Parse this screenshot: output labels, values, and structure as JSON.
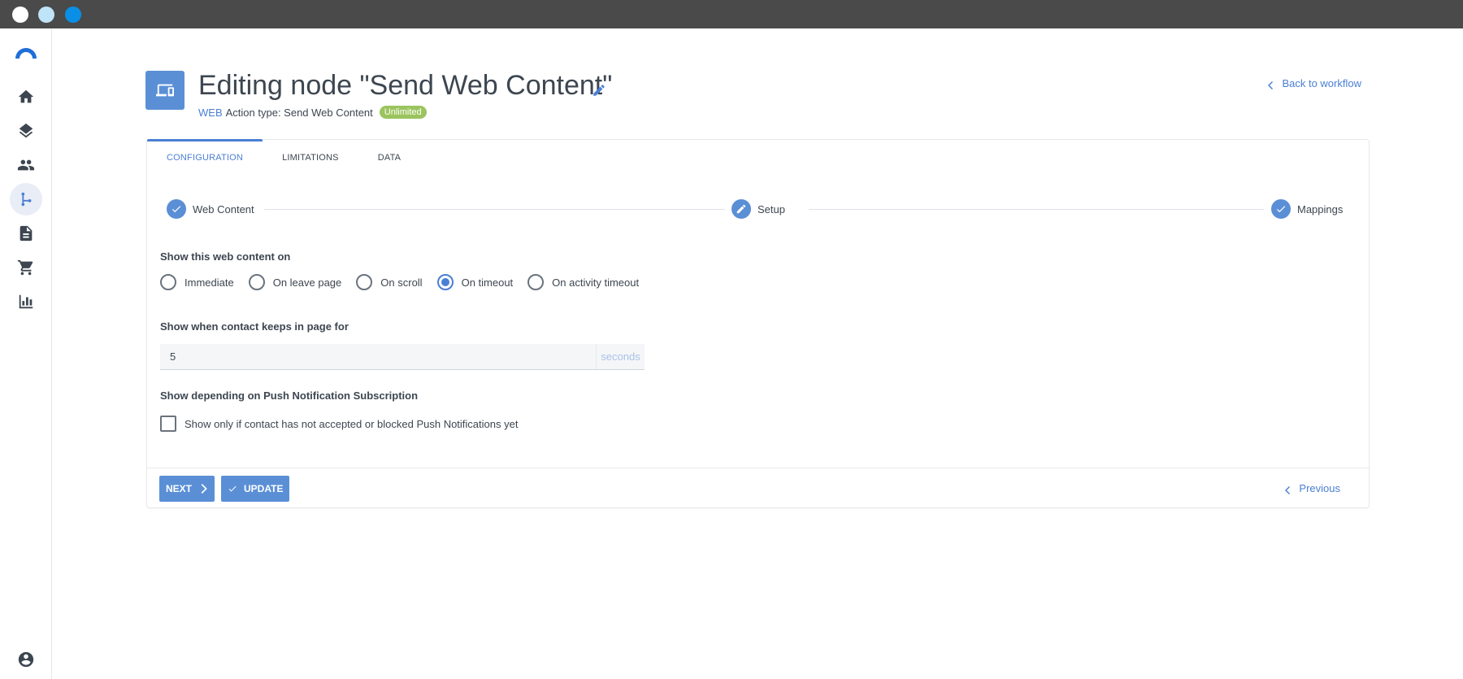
{
  "window": {
    "controls": [
      "close",
      "minimize",
      "maximize"
    ]
  },
  "sidebar": {
    "logo": "brand-logo",
    "items": [
      {
        "icon": "home-icon",
        "active": false
      },
      {
        "icon": "layers-icon",
        "active": false
      },
      {
        "icon": "people-icon",
        "active": false
      },
      {
        "icon": "workflow-icon",
        "active": true
      },
      {
        "icon": "document-icon",
        "active": false
      },
      {
        "icon": "cart-icon",
        "active": false
      },
      {
        "icon": "bar-chart-icon",
        "active": false
      }
    ],
    "bottom_icon": "account-icon"
  },
  "header": {
    "title": "Editing node \"Send Web Content\"",
    "channel": "WEB",
    "action_type": "Action type: Send Web Content",
    "badge": "Unlimited",
    "back_link": "Back to workflow"
  },
  "tabs": [
    {
      "label": "CONFIGURATION",
      "active": true
    },
    {
      "label": "LIMITATIONS",
      "active": false
    },
    {
      "label": "DATA",
      "active": false
    }
  ],
  "steps": [
    {
      "label": "Web Content",
      "state": "done"
    },
    {
      "label": "Setup",
      "state": "current"
    },
    {
      "label": "Mappings",
      "state": "done"
    }
  ],
  "form": {
    "show_on_label": "Show this web content on",
    "show_on_options": [
      "Immediate",
      "On leave page",
      "On scroll",
      "On timeout",
      "On activity timeout"
    ],
    "show_on_selected": "On timeout",
    "keep_label": "Show when contact keeps in page for",
    "keep_value": "5",
    "keep_unit": "seconds",
    "push_label": "Show depending on Push Notification Subscription",
    "push_checkbox_label": "Show only if contact has not accepted or blocked Push Notifications yet",
    "push_checked": false
  },
  "footer": {
    "next_label": "NEXT",
    "update_label": "UPDATE",
    "previous_label": "Previous"
  },
  "colors": {
    "accent": "#4a7fd4",
    "accent_fill": "#5a8fd6",
    "badge": "#9bc45f",
    "topbar": "#4a4a4a"
  }
}
